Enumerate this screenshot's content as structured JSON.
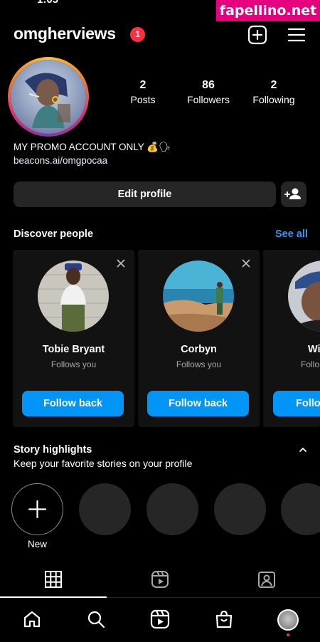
{
  "watermark": "fapellino.net",
  "status_time": "1:05",
  "profile": {
    "username": "omgherviews",
    "notification_count": "1",
    "bio": "MY PROMO ACCOUNT ONLY 💰🗣",
    "link": "beacons.ai/omgpocaa",
    "stats": [
      {
        "value": "2",
        "label": "Posts"
      },
      {
        "value": "86",
        "label": "Followers"
      },
      {
        "value": "2",
        "label": "Following"
      }
    ],
    "edit_label": "Edit profile"
  },
  "discover": {
    "title": "Discover people",
    "see_all": "See all",
    "cards": [
      {
        "name": "Tobie Bryant",
        "subtitle": "Follows you",
        "button": "Follow back"
      },
      {
        "name": "Corbyn",
        "subtitle": "Follows you",
        "button": "Follow back"
      },
      {
        "name": "Wi",
        "subtitle": "Follo",
        "button": "Follo"
      }
    ]
  },
  "highlights": {
    "title": "Story highlights",
    "subtitle": "Keep your favorite stories on your profile",
    "new_label": "New"
  },
  "icons": {
    "add": "plus-square-icon",
    "menu": "hamburger-menu-icon",
    "grid": "grid-icon",
    "reels": "reels-icon",
    "tagged": "tagged-icon",
    "home": "home-icon",
    "search": "search-icon",
    "shop": "shop-icon"
  },
  "colors": {
    "accent": "#0095f6",
    "link": "#3797f0",
    "badge": "#ff3040",
    "card_bg": "#121212",
    "button_bg": "#262626"
  }
}
